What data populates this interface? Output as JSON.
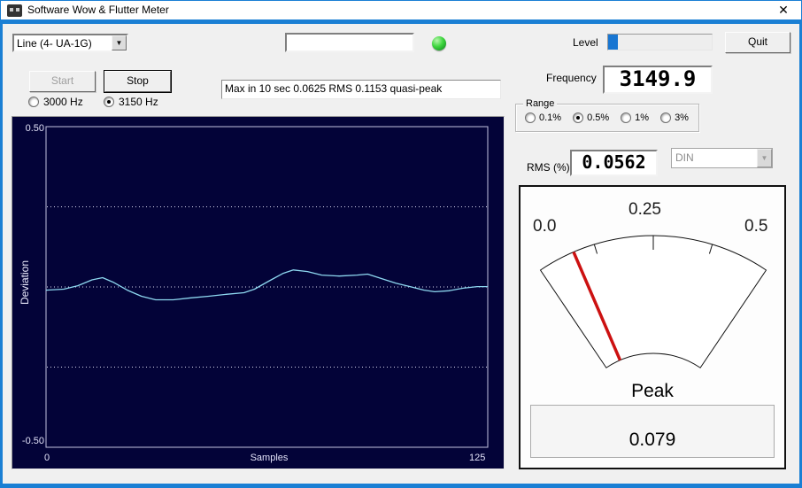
{
  "window": {
    "title": "Software Wow & Flutter Meter"
  },
  "icons": {
    "close": "✕",
    "dropdown": "▼"
  },
  "toolbar": {
    "input_device": "Line (4- UA-1G)",
    "message_value": "",
    "level_label": "Level",
    "level_percent": 9,
    "quit_label": "Quit",
    "start_label": "Start",
    "stop_label": "Stop",
    "freq_options": [
      {
        "label": "3000 Hz",
        "selected": false
      },
      {
        "label": "3150 Hz",
        "selected": true
      }
    ],
    "status_text": "Max in 10 sec 0.0625 RMS 0.1153 quasi-peak"
  },
  "readouts": {
    "frequency_label": "Frequency",
    "frequency_value": "3149.9",
    "range_label": "Range",
    "range_options": [
      {
        "label": "0.1%",
        "selected": false
      },
      {
        "label": "0.5%",
        "selected": true
      },
      {
        "label": "1%",
        "selected": false
      },
      {
        "label": "3%",
        "selected": false
      }
    ],
    "rms_label": "RMS (%)",
    "rms_value": "0.0562",
    "weighting_value": "DIN"
  },
  "meter": {
    "min": 0,
    "max": 0.5,
    "value": 0.079,
    "min_label": "0.0",
    "mid_label": "0.25",
    "max_label": "0.5",
    "tick_fractions": [
      0.25,
      0.5,
      0.75
    ],
    "peak_label": "Peak",
    "peak_value": "0.079"
  },
  "chart_data": {
    "type": "line",
    "title": "",
    "xlabel": "Samples",
    "ylabel": "Deviation",
    "xlim": [
      0,
      125
    ],
    "ylim": [
      -0.5,
      0.5
    ],
    "x_tick_labels": [
      "0",
      "125"
    ],
    "y_tick_labels": [
      "0.50",
      "-0.50"
    ],
    "gridlines_y": [
      0.25,
      0,
      -0.25
    ],
    "grid_style": "dotted",
    "legend": "none",
    "x": [
      0,
      5,
      9,
      13,
      16,
      19,
      23,
      27,
      31,
      36,
      41,
      46,
      51,
      56,
      59,
      63,
      67,
      70,
      74,
      78,
      83,
      88,
      91,
      95,
      99,
      103,
      107,
      110,
      114,
      118,
      122,
      125
    ],
    "y": [
      -0.01,
      -0.007,
      0.004,
      0.022,
      0.029,
      0.015,
      -0.01,
      -0.029,
      -0.04,
      -0.04,
      -0.034,
      -0.029,
      -0.023,
      -0.018,
      -0.007,
      0.018,
      0.042,
      0.053,
      0.048,
      0.037,
      0.034,
      0.037,
      0.04,
      0.026,
      0.012,
      0.001,
      -0.01,
      -0.015,
      -0.012,
      -0.004,
      0.001,
      0.001
    ]
  },
  "colors": {
    "window_border": "#1a7fd4",
    "chart_bg": "#030338",
    "curve": "#8ed8f0",
    "grid": "#d7d7ee",
    "plot_border": "#c3c3df",
    "needle": "#cc1111",
    "progress_fill": "#1876d2",
    "led": "#3ed63e"
  }
}
